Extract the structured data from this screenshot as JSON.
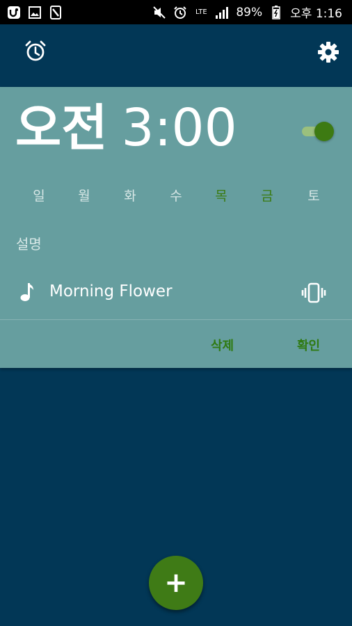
{
  "status_bar": {
    "battery_percent": "89%",
    "time": "오후 1:16",
    "network": "LTE"
  },
  "alarm": {
    "ampm": "오전",
    "time": "3:00",
    "enabled": true,
    "days": [
      {
        "label": "일",
        "active": false
      },
      {
        "label": "월",
        "active": false
      },
      {
        "label": "화",
        "active": false
      },
      {
        "label": "수",
        "active": false
      },
      {
        "label": "목",
        "active": true
      },
      {
        "label": "금",
        "active": true
      },
      {
        "label": "토",
        "active": false
      }
    ],
    "description_label": "설명",
    "ringtone": "Morning Flower",
    "delete_label": "삭제",
    "confirm_label": "확인"
  },
  "fab": {
    "label": "+"
  },
  "colors": {
    "background": "#023756",
    "card": "#669e9f",
    "accent": "#3f7b16"
  }
}
